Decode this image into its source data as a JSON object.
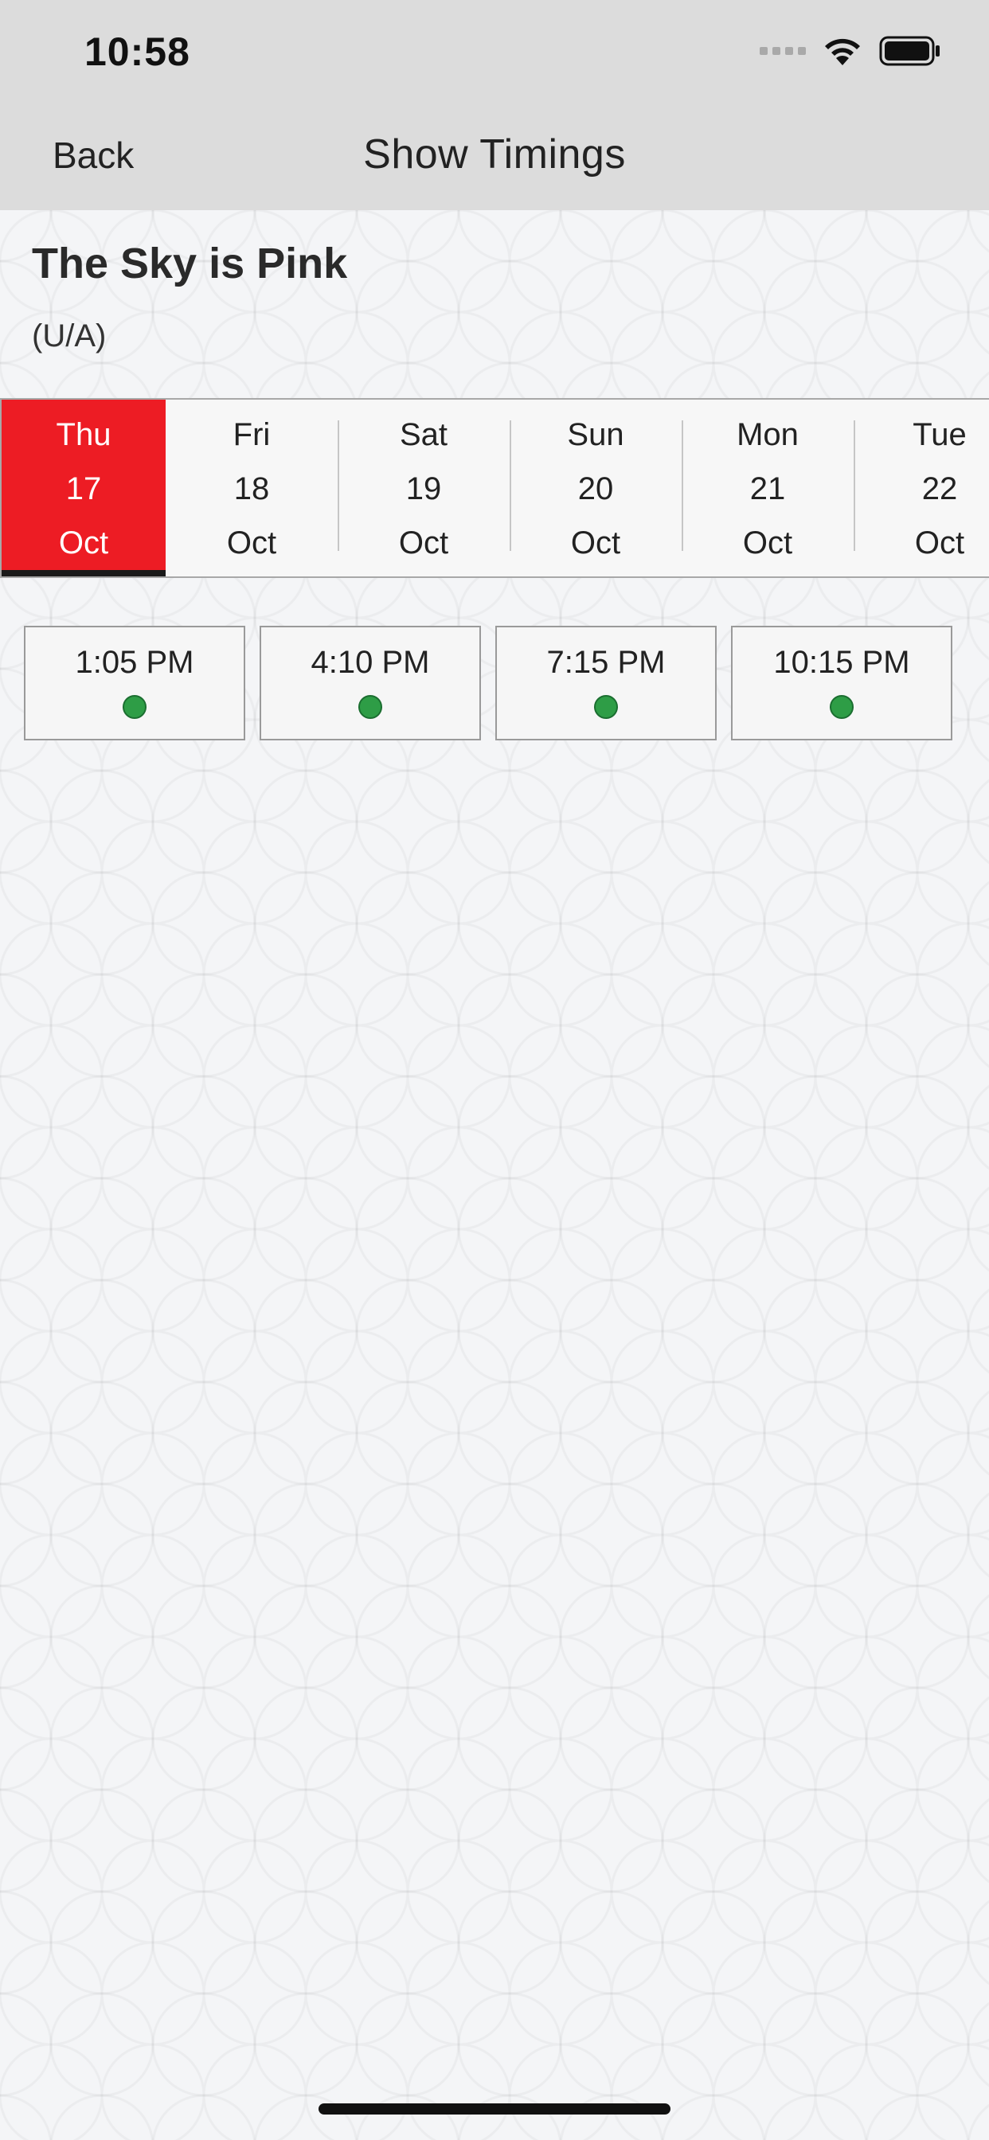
{
  "status_bar": {
    "time": "10:58"
  },
  "nav": {
    "back_label": "Back",
    "title": "Show Timings"
  },
  "movie": {
    "title": "The Sky is Pink",
    "rating": "(U/A)"
  },
  "dates": [
    {
      "day": "Thu",
      "date": "17",
      "month": "Oct",
      "selected": true
    },
    {
      "day": "Fri",
      "date": "18",
      "month": "Oct",
      "selected": false
    },
    {
      "day": "Sat",
      "date": "19",
      "month": "Oct",
      "selected": false
    },
    {
      "day": "Sun",
      "date": "20",
      "month": "Oct",
      "selected": false
    },
    {
      "day": "Mon",
      "date": "21",
      "month": "Oct",
      "selected": false
    },
    {
      "day": "Tue",
      "date": "22",
      "month": "Oct",
      "selected": false
    }
  ],
  "show_times": [
    {
      "time": "1:05 PM"
    },
    {
      "time": "4:10 PM"
    },
    {
      "time": "7:15 PM"
    },
    {
      "time": "10:15 PM"
    }
  ],
  "colors": {
    "accent": "#ed1c24",
    "available": "#2e9d46",
    "header_bg": "#dcdcdc"
  },
  "icons": {
    "signal": "cellular-signal-icon",
    "wifi": "wifi-icon",
    "battery": "battery-icon"
  }
}
